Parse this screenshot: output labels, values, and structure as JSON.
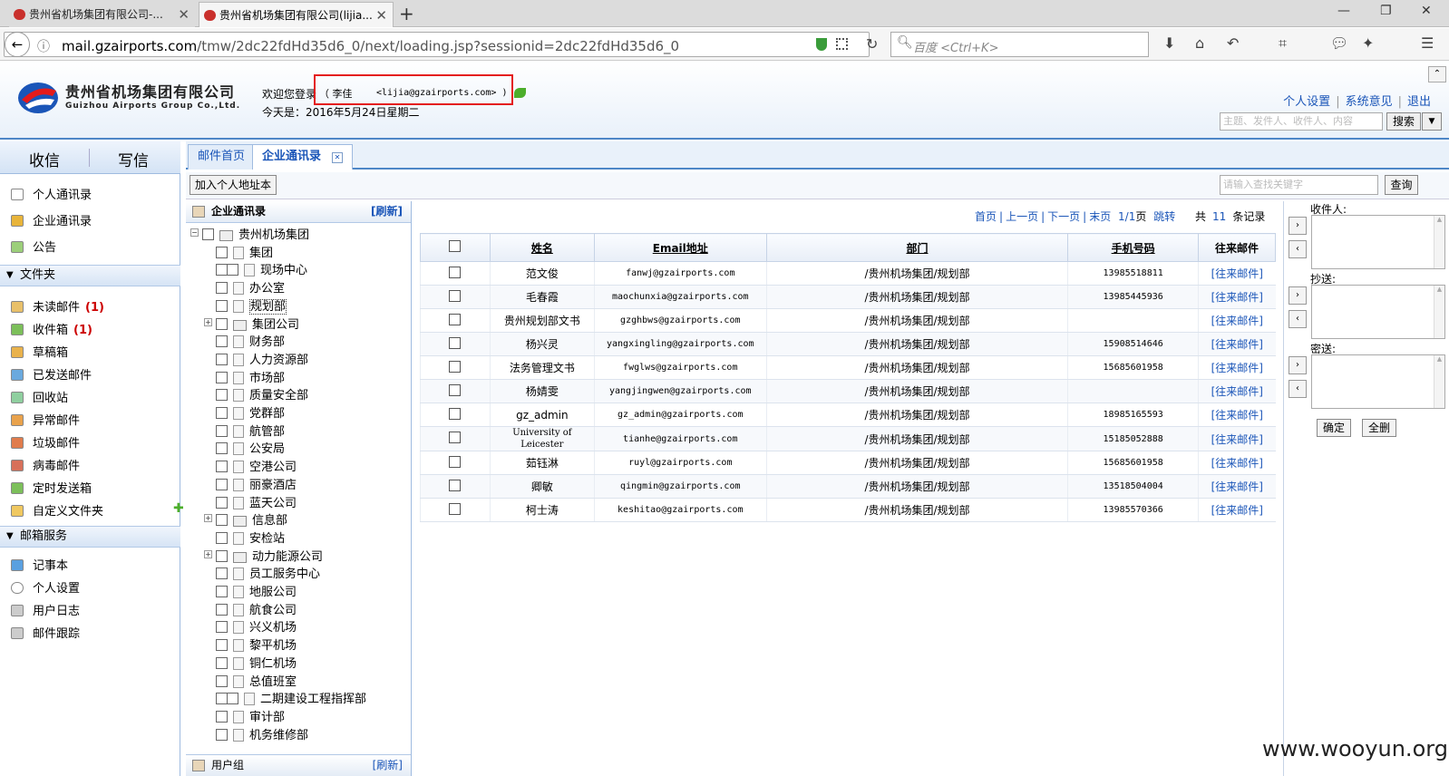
{
  "browser": {
    "tabs": [
      {
        "title": "贵州省机场集团有限公司-..."
      },
      {
        "title": "贵州省机场集团有限公司(lijia..."
      }
    ],
    "url_prefix": "mail.gzairports.com",
    "url_rest": "/tmw/2dc22fdHd35d6_0/next/loading.jsp?sessionid=2dc22fdHd35d6_0",
    "search_placeholder": "百度 <Ctrl+K>"
  },
  "header": {
    "company_cn": "贵州省机场集团有限公司",
    "company_en": "Guizhou Airports Group Co.,Ltd.",
    "welcome": "欢迎您登录",
    "user_name": "（ 李佳",
    "user_email": "<lijia@gzairports.com> )",
    "today": "今天是：2016年5月24日星期二",
    "links": [
      "个人设置",
      "系统意见",
      "退出"
    ],
    "search_placeholder": "主题、发件人、收件人、内容",
    "search_button": "搜索"
  },
  "leftnav": {
    "receive": "收信",
    "compose": "写信",
    "contacts": [
      "个人通讯录",
      "企业通讯录",
      "公告"
    ],
    "folders_title": "文件夹",
    "folders": [
      {
        "label": "未读邮件",
        "count": "(1)"
      },
      {
        "label": "收件箱",
        "count": "(1)"
      },
      {
        "label": "草稿箱",
        "count": ""
      },
      {
        "label": "已发送邮件",
        "count": ""
      },
      {
        "label": "回收站",
        "count": ""
      },
      {
        "label": "异常邮件",
        "count": ""
      },
      {
        "label": "垃圾邮件",
        "count": ""
      },
      {
        "label": "病毒邮件",
        "count": ""
      },
      {
        "label": "定时发送箱",
        "count": ""
      },
      {
        "label": "自定义文件夹",
        "count": ""
      }
    ],
    "services_title": "邮箱服务",
    "services": [
      "记事本",
      "个人设置",
      "用户日志",
      "邮件跟踪"
    ]
  },
  "main": {
    "tabs": [
      "邮件首页",
      "企业通讯录"
    ],
    "add_button": "加入个人地址本",
    "query_placeholder": "请输入查找关键字",
    "query_button": "查询"
  },
  "tree": {
    "title": "企业通讯录",
    "refresh": "[刷新]",
    "root": "贵州机场集团",
    "nodes": [
      "集团",
      "现场中心",
      "办公室",
      "规划部",
      "集团公司",
      "财务部",
      "人力资源部",
      "市场部",
      "质量安全部",
      "党群部",
      "航管部",
      "公安局",
      "空港公司",
      "丽豪酒店",
      "蓝天公司",
      "信息部",
      "安检站",
      "动力能源公司",
      "员工服务中心",
      "地服公司",
      "航食公司",
      "兴义机场",
      "黎平机场",
      "铜仁机场",
      "总值班室",
      "二期建设工程指挥部",
      "审计部",
      "机务维修部"
    ],
    "footer": "用户组",
    "footer_refresh": "[刷新]"
  },
  "pager": {
    "first": "首页",
    "prev": "上一页",
    "next": "下一页",
    "last": "末页",
    "page": "1/1",
    "page_unit": "页",
    "jump": "跳转",
    "total_prefix": "共",
    "total": "11",
    "total_suffix": "条记录"
  },
  "table": {
    "headers": [
      "姓名",
      "Email地址",
      "部门",
      "手机号码",
      "往来邮件"
    ],
    "rows": [
      {
        "name": "范文俊",
        "email": "fanwj@gzairports.com",
        "dept": "/贵州机场集团/规划部",
        "mobile": "13985518811",
        "link": "[往来邮件]"
      },
      {
        "name": "毛春霞",
        "email": "maochunxia@gzairports.com",
        "dept": "/贵州机场集团/规划部",
        "mobile": "13985445936",
        "link": "[往来邮件]"
      },
      {
        "name": "贵州规划部文书",
        "email": "gzghbws@gzairports.com",
        "dept": "/贵州机场集团/规划部",
        "mobile": "",
        "link": "[往来邮件]"
      },
      {
        "name": "杨兴灵",
        "email": "yangxingling@gzairports.com",
        "dept": "/贵州机场集团/规划部",
        "mobile": "15908514646",
        "link": "[往来邮件]"
      },
      {
        "name": "法务管理文书",
        "email": "fwglws@gzairports.com",
        "dept": "/贵州机场集团/规划部",
        "mobile": "15685601958",
        "link": "[往来邮件]"
      },
      {
        "name": "杨婧雯",
        "email": "yangjingwen@gzairports.com",
        "dept": "/贵州机场集团/规划部",
        "mobile": "",
        "link": "[往来邮件]"
      },
      {
        "name": "gz_admin",
        "email": "gz_admin@gzairports.com",
        "dept": "/贵州机场集团/规划部",
        "mobile": "18985165593",
        "link": "[往来邮件]"
      },
      {
        "name": "University of Leicester",
        "email": "tianhe@gzairports.com",
        "dept": "/贵州机场集团/规划部",
        "mobile": "15185052888",
        "link": "[往来邮件]"
      },
      {
        "name": "茹钰淋",
        "email": "ruyl@gzairports.com",
        "dept": "/贵州机场集团/规划部",
        "mobile": "15685601958",
        "link": "[往来邮件]"
      },
      {
        "name": "卿敏",
        "email": "qingmin@gzairports.com",
        "dept": "/贵州机场集团/规划部",
        "mobile": "13518504004",
        "link": "[往来邮件]"
      },
      {
        "name": "柯士涛",
        "email": "keshitao@gzairports.com",
        "dept": "/贵州机场集团/规划部",
        "mobile": "13985570366",
        "link": "[往来邮件]"
      }
    ]
  },
  "recipients": {
    "to": "收件人:",
    "cc": "抄送:",
    "bcc": "密送:",
    "ok": "确定",
    "select_all": "全删"
  },
  "watermark": "www.wooyun.org"
}
